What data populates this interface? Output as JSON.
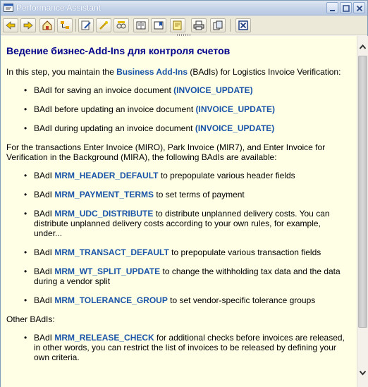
{
  "window": {
    "title": "Performance Assistant",
    "controls": [
      "minimize-icon",
      "maximize-icon",
      "close-icon"
    ]
  },
  "toolbar": {
    "buttons": [
      {
        "icon": "back-arrow-icon"
      },
      {
        "icon": "forward-arrow-icon"
      },
      {
        "icon": "home-icon"
      },
      {
        "icon": "structure-icon"
      },
      {
        "icon": "edit-icon"
      },
      {
        "icon": "pointer-icon"
      },
      {
        "icon": "glasses-icon"
      },
      {
        "icon": "book-icon"
      },
      {
        "icon": "bookmark-icon"
      },
      {
        "icon": "note-icon"
      },
      {
        "icon": "print-icon"
      },
      {
        "icon": "copy-icon"
      },
      {
        "icon": "exit-icon"
      }
    ]
  },
  "content": {
    "heading": "Ведение бизнес-Add-Ins для контроля счетов",
    "intro_before": "In this step, you maintain the ",
    "intro_link": "Business Add-Ins",
    "intro_after": " (BAdIs) for Logistics Invoice Verification:",
    "list1": [
      {
        "text": "BAdI for saving an invoice document ",
        "link": "(INVOICE_UPDATE)",
        "after": ""
      },
      {
        "text": "BAdI before updating an invoice document ",
        "link": "(INVOICE_UPDATE)",
        "after": ""
      },
      {
        "text": "BAdI during updating an invoice document ",
        "link": "(INVOICE_UPDATE)",
        "after": ""
      }
    ],
    "para2": "For the transactions Enter Invoice (MIRO), Park Invoice (MIR7), and Enter Invoice for Verification in the Background (MIRA), the following BAdIs are available:",
    "list2": [
      {
        "text": "BAdI ",
        "link": "MRM_HEADER_DEFAULT",
        "after": " to prepopulate various header fields"
      },
      {
        "text": "BAdI ",
        "link": "MRM_PAYMENT_TERMS",
        "after": " to set terms of payment"
      },
      {
        "text": "BAdI ",
        "link": "MRM_UDC_DISTRIBUTE",
        "after": " to distribute unplanned delivery costs. You can distribute unplanned delivery costs according to your own rules, for example, under..."
      },
      {
        "text": "BAdI ",
        "link": "MRM_TRANSACT_DEFAULT",
        "after": " to prepopulate various transaction fields"
      },
      {
        "text": "BAdI ",
        "link": "MRM_WT_SPLIT_UPDATE",
        "after": " to change the withholding tax data and the data during a vendor split"
      },
      {
        "text": "BAdI ",
        "link": "MRM_TOLERANCE_GROUP",
        "after": " to set vendor-specific tolerance groups"
      }
    ],
    "para3": "Other BAdIs:",
    "list3": [
      {
        "text": "BAdI ",
        "link": "MRM_RELEASE_CHECK",
        "after": " for additional checks before invoices are released, in other words, you can restrict the list of invoices to be released by defining your own criteria."
      }
    ]
  },
  "colors": {
    "heading": "#00008b",
    "link": "#1a54a8",
    "content_bg": "#ffffe6"
  }
}
